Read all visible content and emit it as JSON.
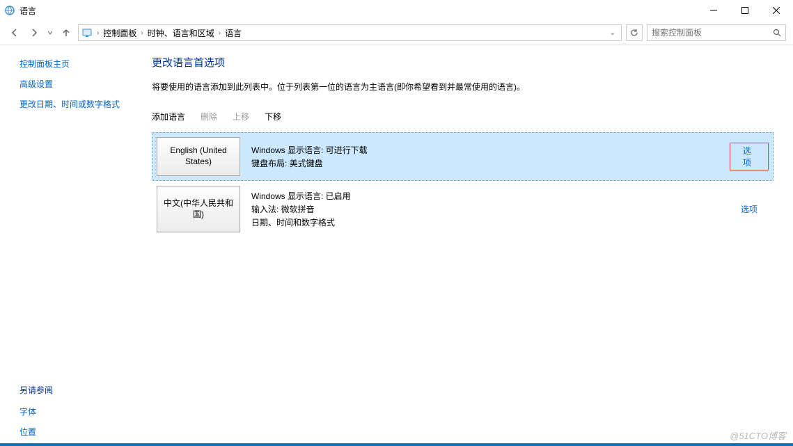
{
  "window": {
    "title": "语言"
  },
  "breadcrumb": {
    "items": [
      "控制面板",
      "时钟、语言和区域",
      "语言"
    ]
  },
  "search": {
    "placeholder": "搜索控制面板"
  },
  "sidebar": {
    "home": "控制面板主页",
    "links": [
      "高级设置",
      "更改日期、时间或数字格式"
    ],
    "see_also_label": "另请参阅",
    "see_also": [
      "字体",
      "位置"
    ]
  },
  "main": {
    "heading": "更改语言首选项",
    "sub": "将要使用的语言添加到此列表中。位于列表第一位的语言为主语言(即你希望看到并最常使用的语言)。",
    "actions": {
      "add": "添加语言",
      "remove": "删除",
      "up": "上移",
      "down": "下移"
    }
  },
  "languages": [
    {
      "name": "English (United States)",
      "details": [
        "Windows 显示语言: 可进行下载",
        "键盘布局: 美式键盘"
      ],
      "options_label": "选项",
      "selected": true,
      "highlight_options": true
    },
    {
      "name": "中文(中华人民共和国)",
      "details": [
        "Windows 显示语言: 已启用",
        "输入法: 微软拼音",
        "日期、时间和数字格式"
      ],
      "options_label": "选项",
      "selected": false,
      "highlight_options": false
    }
  ],
  "watermark": "@51CTO博客"
}
